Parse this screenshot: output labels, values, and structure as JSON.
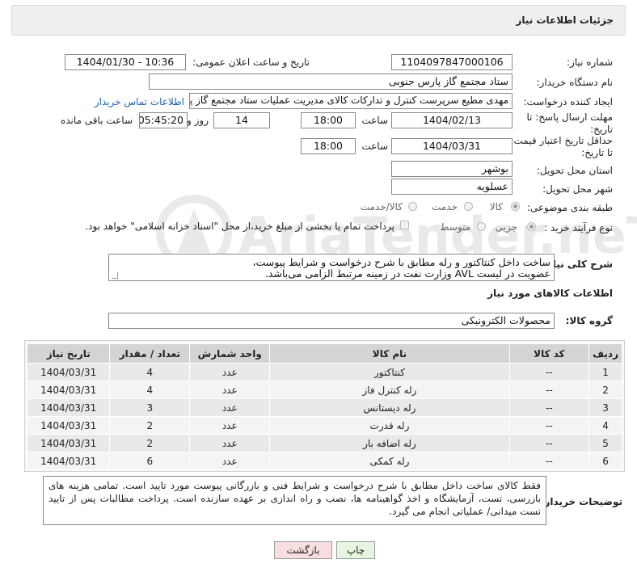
{
  "header": {
    "title": "جزئیات اطلاعات نیاز"
  },
  "form": {
    "need_number_label": "شماره نیاز:",
    "need_number": "1104097847000106",
    "announce_label": "تاریخ و ساعت اعلان عمومی:",
    "announce_value": "1404/01/30 - 10:36",
    "buyer_org_label": "نام دستگاه خریدار:",
    "buyer_org": "ستاد مجتمع گاز پارس جنوبی",
    "creator_label": "ایجاد کننده درخواست:",
    "creator": "مهدی مطیع سرپرست کنترل و تدارکات کالای مدیریت عملیات ستاد مجتمع گاز پا",
    "contact_link": "اطلاعات تماس خریدار",
    "deadline_label_1": "مهلت ارسال پاسخ: تا",
    "deadline_label_2": "تاریخ:",
    "deadline_date": "1404/02/13",
    "time_label": "ساعت",
    "deadline_time": "18:00",
    "days_count": "14",
    "day_label": "روز و",
    "remaining_time": "05:45:20",
    "remaining_label": "ساعت باقی مانده",
    "validity_label_1": "حداقل تاریخ اعتبار قیمت:",
    "validity_label_2": "تا تاریخ:",
    "validity_date": "1404/03/31",
    "validity_time": "18:00",
    "province_label": "استان محل تحویل:",
    "province": "بوشهر",
    "city_label": "شهر محل تحویل:",
    "city": "عسلویه",
    "category_label": "طبقه بندی موضوعی:",
    "category_options": [
      "کالا",
      "خدمت",
      "کالا/خدمت"
    ],
    "category_selected": "کالا",
    "process_label": "نوع فرآیند خرید :",
    "process_options": [
      "جزیی",
      "متوسط"
    ],
    "process_selected": "جزیی",
    "payment_note": "پرداخت تمام یا بخشی از مبلغ خرید،از محل \"اسناد خزانه اسلامی\" خواهد بود.",
    "description_label": "شرح کلی نیاز:",
    "description_line1": "ساخت داخل کنتاکتور و رله مطابق با شرح درخواست و شرایط پیوست،",
    "description_line2": "عضویت در لیست AVL وزارت نفت در زمینه مرتبط الزامی می‌باشد."
  },
  "goods": {
    "section_title": "اطلاعات کالاهای مورد نیاز",
    "group_label": "گروه کالا:",
    "group_value": "محصولات الکترونیکی",
    "columns": [
      "ردیف",
      "کد کالا",
      "نام کالا",
      "واحد شمارش",
      "تعداد / مقدار",
      "تاریخ نیاز"
    ],
    "rows": [
      {
        "row": "1",
        "code": "--",
        "name": "کنتاکتور",
        "unit": "عدد",
        "qty": "4",
        "date": "1404/03/31"
      },
      {
        "row": "2",
        "code": "--",
        "name": "رله کنترل فاز",
        "unit": "عدد",
        "qty": "4",
        "date": "1404/03/31"
      },
      {
        "row": "3",
        "code": "--",
        "name": "رله دیستانس",
        "unit": "عدد",
        "qty": "3",
        "date": "1404/03/31"
      },
      {
        "row": "4",
        "code": "--",
        "name": "رله قدرت",
        "unit": "عدد",
        "qty": "2",
        "date": "1404/03/31"
      },
      {
        "row": "5",
        "code": "--",
        "name": "رله اضافه بار",
        "unit": "عدد",
        "qty": "2",
        "date": "1404/03/31"
      },
      {
        "row": "6",
        "code": "--",
        "name": "رله کمکی",
        "unit": "عدد",
        "qty": "6",
        "date": "1404/03/31"
      }
    ]
  },
  "notes": {
    "label": "توضیحات خریدار:",
    "text": "فقط کالای ساخت داخل مطابق با شرح درخواست و شرایط فنی و بازرگانی پیوست مورد تایید است. تمامی هزینه های بازرسی، تست، آزمایشگاه و اخذ گواهینامه ها، نصب و راه اندازی بر عهده سازنده است. پرداخت مطالبات پس از تایید تست میدانی/ عملیاتی انجام می گیرد."
  },
  "buttons": {
    "print": "چاپ",
    "back": "بازگشت"
  },
  "watermark": {
    "text": "AriaTender.neT"
  },
  "colors": {
    "link": "#1a64b4",
    "back_button_bg": "#f8dede",
    "print_button_bg": "#e6f6e0"
  }
}
